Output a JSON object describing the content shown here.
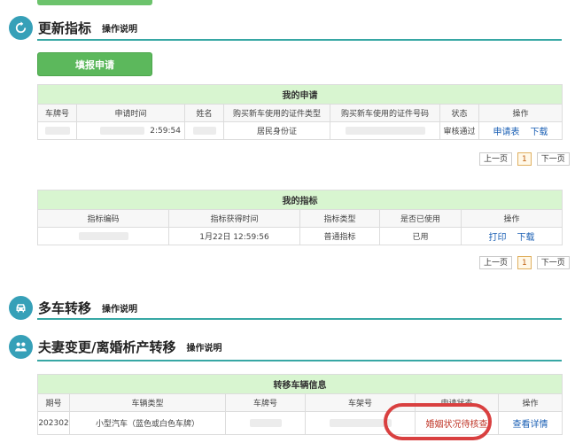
{
  "update_section": {
    "title": "更新指标",
    "help": "操作说明"
  },
  "fill_button": "填报申请",
  "my_application": {
    "caption": "我的申请",
    "headers": [
      "车牌号",
      "申请时间",
      "姓名",
      "购买新车使用的证件类型",
      "购买新车使用的证件号码",
      "状态",
      "操作"
    ],
    "row": {
      "time": "2:59:54",
      "doc_type": "居民身份证",
      "status": "审核通过",
      "action1": "申请表",
      "action2": "下载"
    },
    "pager": {
      "prev": "上一页",
      "page": "1",
      "next": "下一页"
    }
  },
  "my_quota": {
    "caption": "我的指标",
    "headers": [
      "指标编码",
      "指标获得时间",
      "指标类型",
      "是否已使用",
      "操作"
    ],
    "row": {
      "time": "1月22日 12:59:56",
      "type": "普通指标",
      "used": "已用",
      "action1": "打印",
      "action2": "下载"
    },
    "pager": {
      "prev": "上一页",
      "page": "1",
      "next": "下一页"
    }
  },
  "multi_car_section": {
    "title": "多车转移",
    "help": "操作说明"
  },
  "marriage_section": {
    "title": "夫妻变更/离婚析产转移",
    "help": "操作说明"
  },
  "transfer_info": {
    "caption": "转移车辆信息",
    "headers": [
      "期号",
      "车辆类型",
      "车牌号",
      "车架号",
      "申请状态",
      "操作"
    ],
    "row": {
      "period": "202302",
      "vehicle_type": "小型汽车（蓝色或白色车牌）",
      "status": "婚姻状况待核查",
      "action": "查看详情"
    }
  }
}
